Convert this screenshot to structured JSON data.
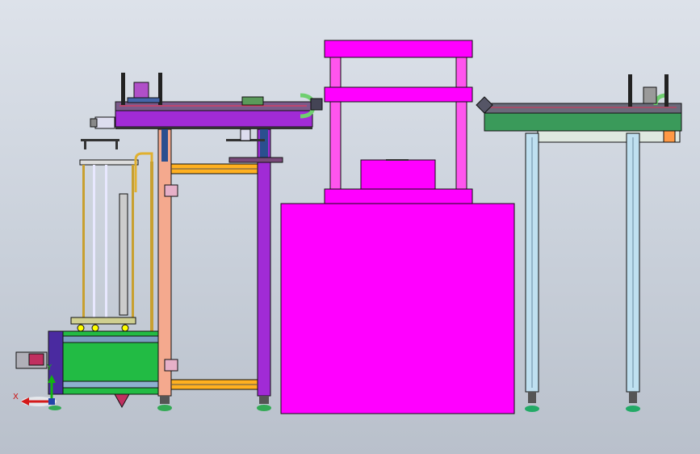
{
  "viewport": {
    "background_top": "#dde2ea",
    "background_bottom": "#b9c0cb"
  },
  "colors": {
    "press_magenta": "#ff00ff",
    "frame_salmon": "#f4a98e",
    "frame_dark": "#2a2a4a",
    "beam_purple": "#a12bd6",
    "conveyor_green": "#3a9a5a",
    "base_green": "#22bb44",
    "rail_orange": "#ffb020",
    "column_blue": "#bfe0f0",
    "outline": "#111111"
  },
  "triad": {
    "x_label": "X",
    "y_label": "Y",
    "x_color": "#d41a1a",
    "y_color": "#12b312"
  },
  "icons": {
    "triad": "coordinate-triad-icon",
    "view_marker": "view-orientation-icon"
  }
}
